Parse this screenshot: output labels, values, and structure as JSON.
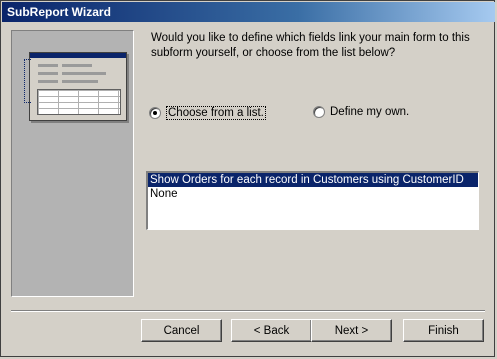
{
  "window": {
    "title": "SubReport Wizard"
  },
  "question": "Would you like to define which fields link your main form to this subform yourself, or choose from the list below?",
  "options": {
    "choose_label": "Choose from a list.",
    "define_label": "Define my own.",
    "selected": "choose"
  },
  "list": {
    "items": [
      "Show Orders for each record in Customers using CustomerID",
      "None"
    ],
    "selected_index": 0
  },
  "buttons": {
    "cancel": "Cancel",
    "back": "< Back",
    "next": "Next >",
    "finish": "Finish"
  }
}
